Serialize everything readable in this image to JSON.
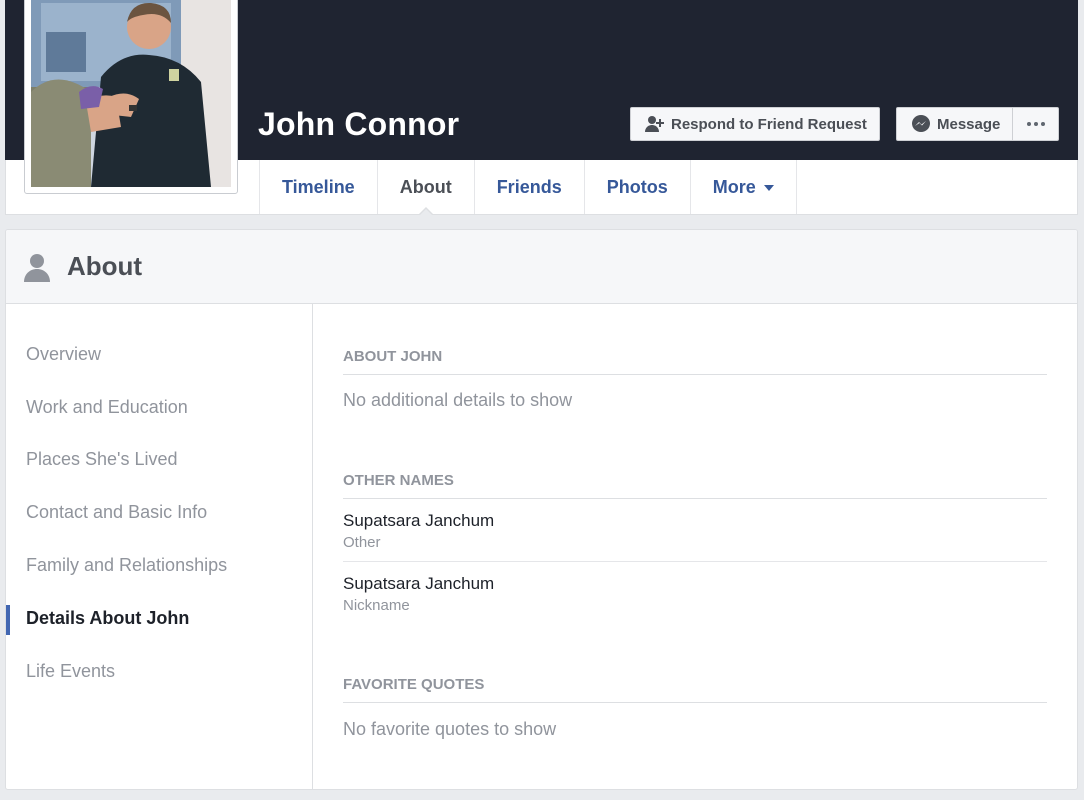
{
  "profile": {
    "name": "John Connor"
  },
  "actions": {
    "friend_request_label": "Respond to Friend Request",
    "message_label": "Message"
  },
  "nav": {
    "tabs": [
      {
        "label": "Timeline"
      },
      {
        "label": "About"
      },
      {
        "label": "Friends"
      },
      {
        "label": "Photos"
      },
      {
        "label": "More"
      }
    ],
    "active_tab": "About"
  },
  "about": {
    "title": "About",
    "sidebar": [
      {
        "label": "Overview"
      },
      {
        "label": "Work and Education"
      },
      {
        "label": "Places She's Lived"
      },
      {
        "label": "Contact and Basic Info"
      },
      {
        "label": "Family and Relationships"
      },
      {
        "label": "Details About John"
      },
      {
        "label": "Life Events"
      }
    ],
    "active_item": "Details About John",
    "sections": {
      "about_john": {
        "title": "ABOUT JOHN",
        "empty": "No additional details to show"
      },
      "other_names": {
        "title": "OTHER NAMES",
        "items": [
          {
            "name": "Supatsara Janchum",
            "type": "Other"
          },
          {
            "name": "Supatsara Janchum",
            "type": "Nickname"
          }
        ]
      },
      "favorite_quotes": {
        "title": "FAVORITE QUOTES",
        "empty": "No favorite quotes to show"
      }
    }
  },
  "colors": {
    "cover": "#1f2431",
    "link": "#365899",
    "accent": "#4267b2",
    "muted_text": "#90949c"
  }
}
